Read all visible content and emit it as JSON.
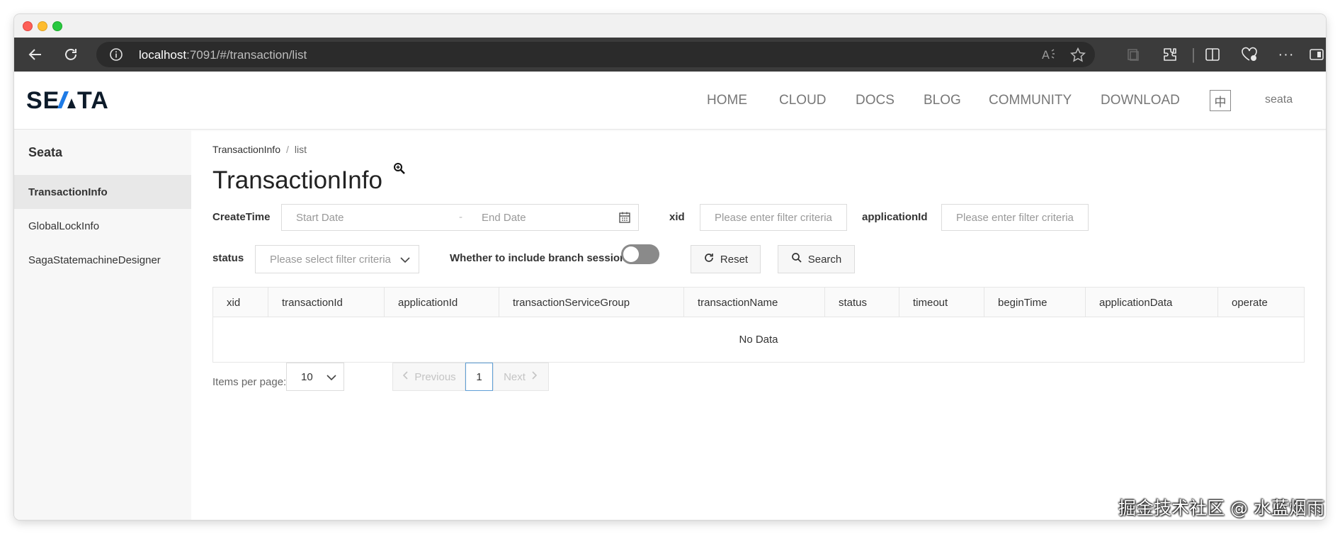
{
  "browser": {
    "url_host": "localhost",
    "url_rest": ":7091/#/transaction/list"
  },
  "header": {
    "nav": [
      "HOME",
      "CLOUD",
      "DOCS",
      "BLOG",
      "COMMUNITY",
      "DOWNLOAD"
    ],
    "lang_button": "中",
    "user": "seata"
  },
  "sidebar": {
    "title": "Seata",
    "items": [
      {
        "label": "TransactionInfo",
        "active": true
      },
      {
        "label": "GlobalLockInfo",
        "active": false
      },
      {
        "label": "SagaStatemachineDesigner",
        "active": false
      }
    ]
  },
  "breadcrumb": {
    "root": "TransactionInfo",
    "separator": "/",
    "current": "list"
  },
  "page_title": "TransactionInfo",
  "filters": {
    "createtime_label": "CreateTime",
    "start_date_placeholder": "Start Date",
    "date_separator": "-",
    "end_date_placeholder": "End Date",
    "xid_label": "xid",
    "xid_placeholder": "Please enter filter criteria",
    "appid_label": "applicationId",
    "appid_placeholder": "Please enter filter criteria",
    "status_label": "status",
    "status_placeholder": "Please select filter criteria",
    "branch_label": "Whether to include branch sessions",
    "branch_toggle_on": false,
    "reset_label": "Reset",
    "search_label": "Search"
  },
  "table": {
    "columns": [
      "xid",
      "transactionId",
      "applicationId",
      "transactionServiceGroup",
      "transactionName",
      "status",
      "timeout",
      "beginTime",
      "applicationData",
      "operate"
    ],
    "empty_text": "No Data"
  },
  "pagination": {
    "items_per_page_label": "Items per page:",
    "page_size": "10",
    "previous_label": "Previous",
    "current_page": "1",
    "next_label": "Next"
  },
  "watermark": "掘金技术社区 @ 水蓝烟雨",
  "colors": {
    "toolbar": "#3b3b3b",
    "sidebar_bg": "#f7f7f7",
    "active_item_bg": "#e8e8e8",
    "logo_dark": "#0d1b2a",
    "logo_accent": "#1e7be6",
    "pager_current_border": "#5f9fd6"
  }
}
